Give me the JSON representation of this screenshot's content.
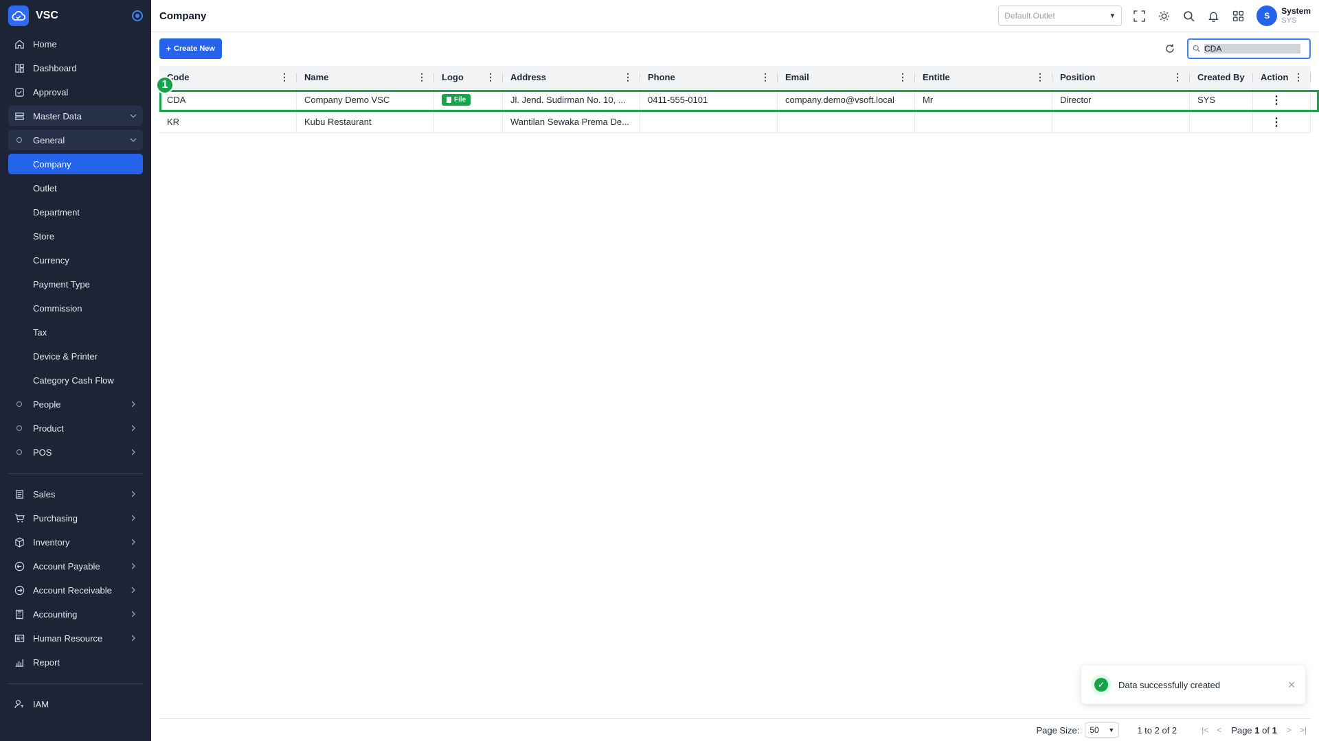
{
  "app": {
    "name": "VSC"
  },
  "sidebar": {
    "items": [
      {
        "label": "Home",
        "icon": "home-icon"
      },
      {
        "label": "Dashboard",
        "icon": "dashboard-icon"
      },
      {
        "label": "Approval",
        "icon": "approval-icon"
      },
      {
        "label": "Master Data",
        "icon": "database-icon"
      },
      {
        "label": "General",
        "icon": "circle-icon"
      },
      {
        "label": "Company"
      },
      {
        "label": "Outlet"
      },
      {
        "label": "Department"
      },
      {
        "label": "Store"
      },
      {
        "label": "Currency"
      },
      {
        "label": "Payment Type"
      },
      {
        "label": "Commission"
      },
      {
        "label": "Tax"
      },
      {
        "label": "Device & Printer"
      },
      {
        "label": "Category Cash Flow"
      },
      {
        "label": "People",
        "icon": "circle-icon"
      },
      {
        "label": "Product",
        "icon": "circle-icon"
      },
      {
        "label": "POS",
        "icon": "circle-icon"
      },
      {
        "label": "Sales",
        "icon": "sales-icon"
      },
      {
        "label": "Purchasing",
        "icon": "cart-icon"
      },
      {
        "label": "Inventory",
        "icon": "box-icon"
      },
      {
        "label": "Account Payable",
        "icon": "arrow-left-circle-icon"
      },
      {
        "label": "Account Receivable",
        "icon": "arrow-right-circle-icon"
      },
      {
        "label": "Accounting",
        "icon": "calculator-icon"
      },
      {
        "label": "Human Resource",
        "icon": "id-card-icon"
      },
      {
        "label": "Report",
        "icon": "bar-chart-icon"
      },
      {
        "label": "IAM",
        "icon": "user-key-icon"
      }
    ]
  },
  "header": {
    "title": "Company",
    "outlet_placeholder": "Default Outlet",
    "user_initial": "S",
    "user_name": "System",
    "user_code": "SYS"
  },
  "toolbar": {
    "create_label": "Create New",
    "search_value": "CDA"
  },
  "table": {
    "columns": [
      "Code",
      "Name",
      "Logo",
      "Address",
      "Phone",
      "Email",
      "Entitle",
      "Position",
      "Created By",
      "Action"
    ],
    "rows": [
      {
        "code": "CDA",
        "name": "Company Demo VSC",
        "logo": "File",
        "address": "Jl. Jend. Sudirman No. 10, ...",
        "phone": "0411-555-0101",
        "email": "company.demo@vsoft.local",
        "entitle": "Mr",
        "position": "Director",
        "created_by": "SYS"
      },
      {
        "code": "KR",
        "name": "Kubu Restaurant",
        "logo": "",
        "address": "Wantilan Sewaka Prema De...",
        "phone": "",
        "email": "",
        "entitle": "",
        "position": "",
        "created_by": ""
      }
    ]
  },
  "marker": {
    "label": "1"
  },
  "toast": {
    "message": "Data successfully created"
  },
  "pager": {
    "page_size_label": "Page Size:",
    "page_size": "50",
    "range_text": "1 to 2 of 2",
    "page_prefix": "Page",
    "page_current": "1",
    "page_of": "of",
    "page_total": "1"
  },
  "colors": {
    "sidebar_bg": "#1d2435",
    "accent": "#2563eb",
    "success": "#16a34a"
  }
}
